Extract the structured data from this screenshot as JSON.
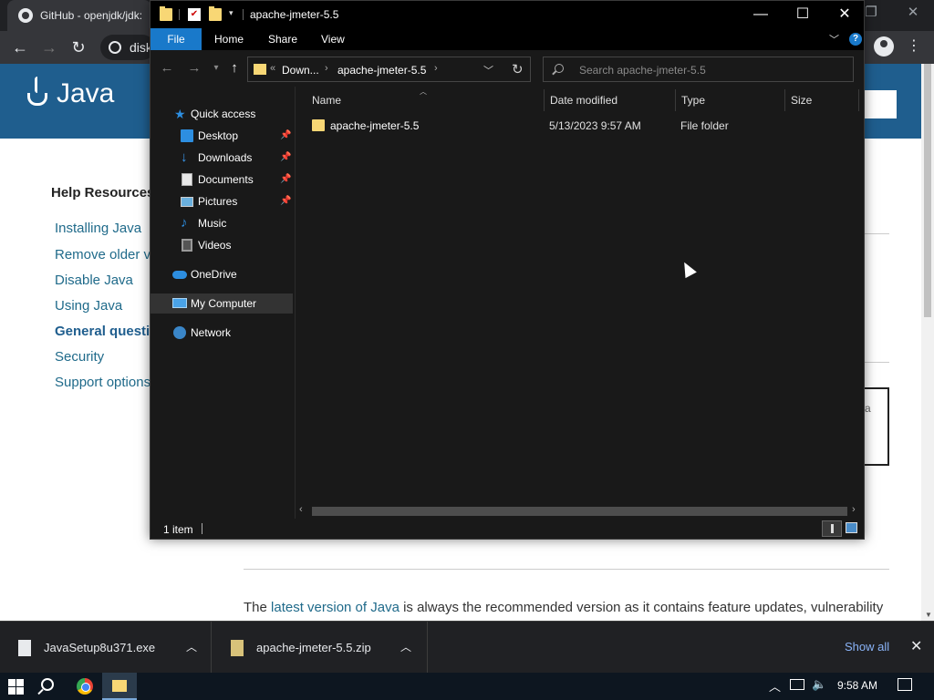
{
  "browser": {
    "tab_title": "GitHub - openjdk/jdk:",
    "omnibox_text": "disk",
    "window_controls": {
      "restore": "❐",
      "close": "✕"
    },
    "nav_icons": {
      "back": "←",
      "forward": "→",
      "reload": "↻"
    },
    "menu_icon": "⋮"
  },
  "java_page": {
    "logo_text": "Java",
    "help_heading": "Help Resources",
    "help_links": [
      "Installing Java",
      "Remove older v",
      "Disable Java",
      "Using Java",
      "General questi",
      "Security",
      "Support options"
    ],
    "box_fragment": "a",
    "paragraph_prefix": "The ",
    "paragraph_link": "latest version of Java",
    "paragraph_rest": " is always the recommended version as it contains feature updates, vulnerability"
  },
  "explorer": {
    "title": "apache-jmeter-5.5",
    "window_controls": {
      "minimize": "—",
      "maximize": "☐",
      "close": "✕"
    },
    "ribbon_tabs": [
      "File",
      "Home",
      "Share",
      "View"
    ],
    "address": {
      "overflow": "«",
      "segment1": "Down...",
      "segment2": "apache-jmeter-5.5",
      "separator": "›"
    },
    "search_placeholder": "Search apache-jmeter-5.5",
    "nav_pane": {
      "quick_access": "Quick access",
      "desktop": "Desktop",
      "downloads": "Downloads",
      "documents": "Documents",
      "pictures": "Pictures",
      "music": "Music",
      "videos": "Videos",
      "onedrive": "OneDrive",
      "my_computer": "My Computer",
      "network": "Network"
    },
    "columns": {
      "name": "Name",
      "date": "Date modified",
      "type": "Type",
      "size": "Size"
    },
    "files": [
      {
        "name": "apache-jmeter-5.5",
        "date": "5/13/2023 9:57 AM",
        "type": "File folder",
        "size": ""
      }
    ],
    "status": {
      "count": "1 item"
    }
  },
  "downloads_bar": {
    "items": [
      {
        "name": "JavaSetup8u371.exe"
      },
      {
        "name": "apache-jmeter-5.5.zip"
      }
    ],
    "show_all": "Show all",
    "close_icon": "✕"
  },
  "taskbar": {
    "clock": "9:58 AM"
  }
}
